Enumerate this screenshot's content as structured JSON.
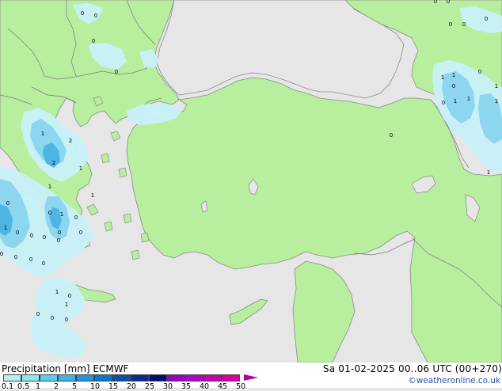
{
  "footer": {
    "title": "Precipitation [mm]  ECMWF",
    "valid_time": "Sa 01-02-2025 00..06 UTC (00+270)",
    "credit": "©weatheronline.co.uk"
  },
  "legend": {
    "labels": [
      "0.1",
      "0.5",
      "1",
      "2",
      "5",
      "10",
      "15",
      "20",
      "25",
      "30",
      "35",
      "40",
      "45",
      "50"
    ],
    "colors": [
      "#b4f0f0",
      "#8ce6f0",
      "#5acdeb",
      "#3cb4e6",
      "#1e96dc",
      "#0a78c8",
      "#0a50aa",
      "#0a2896",
      "#000a78",
      "#9600c8",
      "#b400c8",
      "#c800b4",
      "#dc00a0",
      "#b0009e"
    ]
  },
  "map": {
    "land_color": "#b7ef9e",
    "sea_color": "#e6e6e6",
    "border_color": "#7a7a7a",
    "precip_light_color": "#c8f0f8",
    "precip_mid_color": "#8cd6ef",
    "precip_heavy_color": "#4eb4e2",
    "values": [
      {
        "id": "v1",
        "text": "0"
      },
      {
        "id": "v2",
        "text": "0"
      },
      {
        "id": "v3",
        "text": "0"
      },
      {
        "id": "v4",
        "text": "0"
      },
      {
        "id": "v5",
        "text": "0"
      },
      {
        "id": "v6",
        "text": "0"
      },
      {
        "id": "v7",
        "text": "0"
      },
      {
        "id": "v8",
        "text": "0"
      },
      {
        "id": "v9",
        "text": "0"
      },
      {
        "id": "v10",
        "text": "0"
      },
      {
        "id": "v11",
        "text": "1"
      },
      {
        "id": "v12",
        "text": "1"
      },
      {
        "id": "v13",
        "text": "0"
      },
      {
        "id": "v14",
        "text": "1"
      },
      {
        "id": "v15",
        "text": "0"
      },
      {
        "id": "v16",
        "text": "1"
      },
      {
        "id": "v17",
        "text": "1"
      },
      {
        "id": "v18",
        "text": "1"
      },
      {
        "id": "v19",
        "text": "0"
      },
      {
        "id": "v20",
        "text": "1"
      },
      {
        "id": "v21",
        "text": "1"
      },
      {
        "id": "v22",
        "text": "2"
      },
      {
        "id": "v23",
        "text": "2"
      },
      {
        "id": "v24",
        "text": "1"
      },
      {
        "id": "v25",
        "text": "1"
      },
      {
        "id": "v26",
        "text": "1"
      },
      {
        "id": "v27",
        "text": "0"
      },
      {
        "id": "v28",
        "text": "0"
      },
      {
        "id": "v29",
        "text": "1"
      },
      {
        "id": "v30",
        "text": "0"
      },
      {
        "id": "v31",
        "text": "1"
      },
      {
        "id": "v32",
        "text": "0"
      },
      {
        "id": "v33",
        "text": "0"
      },
      {
        "id": "v34",
        "text": "0"
      },
      {
        "id": "v35",
        "text": "0"
      },
      {
        "id": "v36",
        "text": "0"
      },
      {
        "id": "v37",
        "text": "0"
      },
      {
        "id": "v38",
        "text": "0"
      },
      {
        "id": "v39",
        "text": "0"
      },
      {
        "id": "v40",
        "text": "0"
      },
      {
        "id": "v41",
        "text": "0"
      },
      {
        "id": "v42",
        "text": "1"
      },
      {
        "id": "v43",
        "text": "0"
      },
      {
        "id": "v44",
        "text": "1"
      },
      {
        "id": "v45",
        "text": "0"
      },
      {
        "id": "v46",
        "text": "0"
      },
      {
        "id": "v47",
        "text": "0"
      }
    ]
  }
}
